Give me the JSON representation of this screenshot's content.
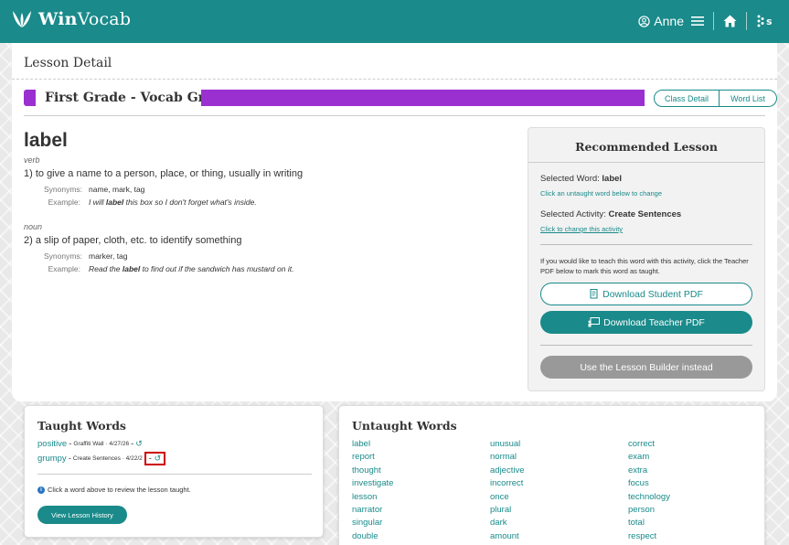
{
  "header": {
    "logo_text_bold": "Win",
    "logo_text_rest": "Vocab",
    "user_name": "Anne",
    "icons": [
      "leaf-logo-icon",
      "user-circle-icon",
      "menu-icon",
      "home-icon",
      "brand-s-icon"
    ]
  },
  "page": {
    "title": "Lesson Detail"
  },
  "grade": {
    "title": "First Grade - Vocab Gr 1",
    "class_detail_label": "Class Detail",
    "word_list_label": "Word List",
    "accent_color": "#9b30d0"
  },
  "word": {
    "title": "label",
    "definitions": [
      {
        "pos": "verb",
        "text": "1) to give a name to a person, place, or thing, usually in writing",
        "synonyms_label": "Synonyms:",
        "synonyms": "name, mark, tag",
        "example_label": "Example:",
        "example_before": "I will ",
        "example_word": "label",
        "example_after": " this box so I don't forget what's inside."
      },
      {
        "pos": "noun",
        "text": "2) a slip of paper, cloth, etc. to identify something",
        "synonyms_label": "Synonyms:",
        "synonyms": "marker, tag",
        "example_label": "Example:",
        "example_before": "Read the ",
        "example_word": "label",
        "example_after": " to find out if the sandwich has mustard on it."
      }
    ]
  },
  "recommended": {
    "title": "Recommended Lesson",
    "selected_word_label": "Selected Word: ",
    "selected_word": "label",
    "change_word_link": "Click an untaught word below to change",
    "selected_activity_label": "Selected Activity: ",
    "selected_activity": "Create Sentences",
    "change_activity_link": "Click to change this activity",
    "note": "If you would like to teach this word with this activity, click the Teacher PDF below to mark this word as taught.",
    "student_pdf_label": "Download Student PDF",
    "teacher_pdf_label": "Download Teacher PDF",
    "builder_label": "Use the Lesson Builder instead"
  },
  "taught": {
    "title": "Taught Words",
    "items": [
      {
        "word": "positive",
        "meta": "Graffiti Wall · 4/27/26",
        "sep": " - ",
        "sep2": " - "
      },
      {
        "word": "grumpy",
        "meta": "Create Sentences · 4/22/2",
        "sep": " - ",
        "sep2": " - "
      }
    ],
    "info_text": "Click a word above to review the lesson taught.",
    "history_label": "View Lesson History"
  },
  "untaught": {
    "title": "Untaught Words",
    "columns": [
      [
        "label",
        "report",
        "thought",
        "investigate",
        "lesson",
        "narrator",
        "singular",
        "double"
      ],
      [
        "unusual",
        "normal",
        "adjective",
        "incorrect",
        "once",
        "plural",
        "dark",
        "amount"
      ],
      [
        "correct",
        "exam",
        "extra",
        "focus",
        "technology",
        "person",
        "total",
        "respect"
      ]
    ]
  },
  "colors": {
    "brand": "#1a8a8a",
    "grey_button": "#999999"
  }
}
